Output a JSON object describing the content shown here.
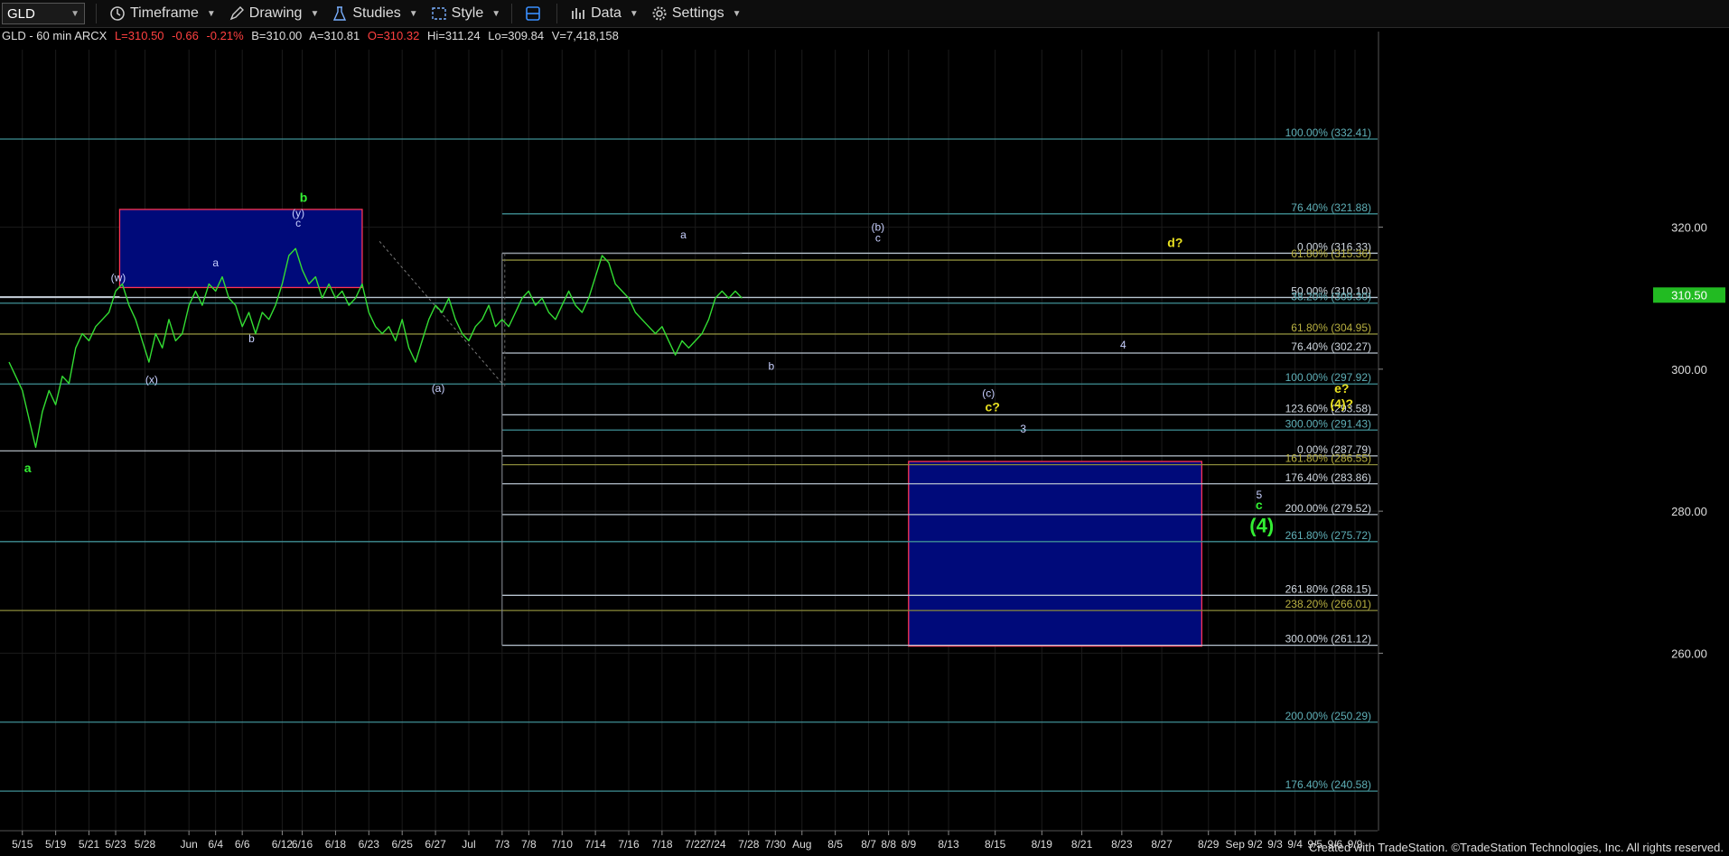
{
  "toolbar": {
    "symbol": "GLD",
    "items": [
      {
        "label": "Timeframe",
        "icon": "clock-icon"
      },
      {
        "label": "Drawing",
        "icon": "pencil-icon"
      },
      {
        "label": "Studies",
        "icon": "flask-icon"
      },
      {
        "label": "Style",
        "icon": "style-icon"
      },
      {
        "label": "",
        "icon": "layout-icon"
      },
      {
        "label": "Data",
        "icon": "bars-icon"
      },
      {
        "label": "Settings",
        "icon": "gear-icon"
      }
    ]
  },
  "infobar": {
    "symbol_info": "GLD - 60 min  ARCX",
    "last": "L=310.50",
    "change": "-0.66",
    "change_pct": "-0.21%",
    "bid": "B=310.00",
    "ask": "A=310.81",
    "open": "O=310.32",
    "high": "Hi=311.24",
    "low": "Lo=309.84",
    "volume": "V=7,418,158"
  },
  "footer": "Created with TradeStation. ©TradeStation Technologies, Inc. All rights reserved.",
  "colors": {
    "background": "#000000",
    "price_line": "#33dd33",
    "box_fill": "#000a7a",
    "box_border": "#ff3355",
    "fib_teal": "#3f8f95",
    "fib_white": "#b8c4d0",
    "fib_yellow": "#8a8a3a",
    "label_green": "#33ee33",
    "label_yellow": "#e8e020",
    "label_white": "#c8d0ff",
    "last_price_tag": "#22bb22"
  },
  "chart_data": {
    "type": "line",
    "title": "GLD - 60 min",
    "ylim": [
      235,
      345
    ],
    "xlim": [
      0,
      101
    ],
    "yticks": [
      260,
      280,
      300,
      320
    ],
    "last_price": "310.50",
    "x_tick_labels": [
      {
        "i": 1,
        "label": "5/15"
      },
      {
        "i": 3.5,
        "label": "5/19"
      },
      {
        "i": 6,
        "label": "5/21"
      },
      {
        "i": 8,
        "label": "5/23"
      },
      {
        "i": 10.2,
        "label": "5/28"
      },
      {
        "i": 13.5,
        "label": "Jun"
      },
      {
        "i": 15.5,
        "label": "6/4"
      },
      {
        "i": 17.5,
        "label": "6/6"
      },
      {
        "i": 20.5,
        "label": "6/12"
      },
      {
        "i": 22,
        "label": "6/16"
      },
      {
        "i": 24.5,
        "label": "6/18"
      },
      {
        "i": 27,
        "label": "6/23"
      },
      {
        "i": 29.5,
        "label": "6/25"
      },
      {
        "i": 32,
        "label": "6/27"
      },
      {
        "i": 34.5,
        "label": "Jul"
      },
      {
        "i": 37,
        "label": "7/3"
      },
      {
        "i": 39,
        "label": "7/8"
      },
      {
        "i": 41.5,
        "label": "7/10"
      },
      {
        "i": 44,
        "label": "7/14"
      },
      {
        "i": 46.5,
        "label": "7/16"
      },
      {
        "i": 49,
        "label": "7/18"
      },
      {
        "i": 51.5,
        "label": "7/22"
      },
      {
        "i": 53,
        "label": "7/24"
      },
      {
        "i": 55.5,
        "label": "7/28"
      },
      {
        "i": 57.5,
        "label": "7/30"
      },
      {
        "i": 59.5,
        "label": "Aug"
      },
      {
        "i": 62,
        "label": "8/5"
      },
      {
        "i": 64.5,
        "label": "8/7"
      },
      {
        "i": 66,
        "label": "8/8"
      },
      {
        "i": 67.5,
        "label": "8/9"
      },
      {
        "i": 70.5,
        "label": "8/13"
      },
      {
        "i": 74,
        "label": "8/15"
      },
      {
        "i": 77.5,
        "label": "8/19"
      },
      {
        "i": 80.5,
        "label": "8/21"
      },
      {
        "i": 83.5,
        "label": "8/23"
      },
      {
        "i": 86.5,
        "label": "8/27"
      },
      {
        "i": 90,
        "label": "8/29"
      },
      {
        "i": 92,
        "label": "Sep"
      },
      {
        "i": 93.5,
        "label": "9/2"
      },
      {
        "i": 95,
        "label": "9/3"
      },
      {
        "i": 96.5,
        "label": "9/4"
      },
      {
        "i": 98,
        "label": "9/5"
      },
      {
        "i": 99.5,
        "label": "9/6"
      },
      {
        "i": 101,
        "label": "9/9"
      }
    ],
    "series": [
      {
        "values": [
          [
            0,
            301
          ],
          [
            0.5,
            299
          ],
          [
            1,
            297
          ],
          [
            1.5,
            293
          ],
          [
            2,
            289
          ],
          [
            2.5,
            294
          ],
          [
            3,
            297
          ],
          [
            3.5,
            295
          ],
          [
            4,
            299
          ],
          [
            4.5,
            298
          ],
          [
            5,
            303
          ],
          [
            5.5,
            305
          ],
          [
            6,
            304
          ],
          [
            6.5,
            306
          ],
          [
            7,
            307
          ],
          [
            7.5,
            308
          ],
          [
            8,
            311
          ],
          [
            8.5,
            312
          ],
          [
            9,
            309
          ],
          [
            9.5,
            307
          ],
          [
            10,
            304
          ],
          [
            10.5,
            301
          ],
          [
            11,
            305
          ],
          [
            11.5,
            303
          ],
          [
            12,
            307
          ],
          [
            12.5,
            304
          ],
          [
            13,
            305
          ],
          [
            13.5,
            309
          ],
          [
            14,
            311
          ],
          [
            14.5,
            309
          ],
          [
            15,
            312
          ],
          [
            15.5,
            311
          ],
          [
            16,
            313
          ],
          [
            16.5,
            310
          ],
          [
            17,
            309
          ],
          [
            17.5,
            306
          ],
          [
            18,
            308
          ],
          [
            18.5,
            305
          ],
          [
            19,
            308
          ],
          [
            19.5,
            307
          ],
          [
            20,
            309
          ],
          [
            20.5,
            312
          ],
          [
            21,
            316
          ],
          [
            21.5,
            317
          ],
          [
            22,
            314
          ],
          [
            22.5,
            312
          ],
          [
            23,
            313
          ],
          [
            23.5,
            310
          ],
          [
            24,
            312
          ],
          [
            24.5,
            310
          ],
          [
            25,
            311
          ],
          [
            25.5,
            309
          ],
          [
            26,
            310
          ],
          [
            26.5,
            312
          ],
          [
            27,
            308
          ],
          [
            27.5,
            306
          ],
          [
            28,
            305
          ],
          [
            28.5,
            306
          ],
          [
            29,
            304
          ],
          [
            29.5,
            307
          ],
          [
            30,
            303
          ],
          [
            30.5,
            301
          ],
          [
            31,
            304
          ],
          [
            31.5,
            307
          ],
          [
            32,
            309
          ],
          [
            32.5,
            308
          ],
          [
            33,
            310
          ],
          [
            33.5,
            307
          ],
          [
            34,
            305
          ],
          [
            34.5,
            304
          ],
          [
            35,
            306
          ],
          [
            35.5,
            307
          ],
          [
            36,
            309
          ],
          [
            36.5,
            306
          ],
          [
            37,
            307
          ],
          [
            37.5,
            306
          ],
          [
            38,
            308
          ],
          [
            38.5,
            310
          ],
          [
            39,
            311
          ],
          [
            39.5,
            309
          ],
          [
            40,
            310
          ],
          [
            40.5,
            308
          ],
          [
            41,
            307
          ],
          [
            41.5,
            309
          ],
          [
            42,
            311
          ],
          [
            42.5,
            309
          ],
          [
            43,
            308
          ],
          [
            43.5,
            310
          ],
          [
            44,
            313
          ],
          [
            44.5,
            316
          ],
          [
            45,
            315
          ],
          [
            45.5,
            312
          ],
          [
            46,
            311
          ],
          [
            46.5,
            310
          ],
          [
            47,
            308
          ],
          [
            47.5,
            307
          ],
          [
            48,
            306
          ],
          [
            48.5,
            305
          ],
          [
            49,
            306
          ],
          [
            49.5,
            304
          ],
          [
            50,
            302
          ],
          [
            50.5,
            304
          ],
          [
            51,
            303
          ],
          [
            51.5,
            304
          ],
          [
            52,
            305
          ],
          [
            52.5,
            307
          ],
          [
            53,
            310
          ],
          [
            53.5,
            311
          ],
          [
            54,
            310
          ],
          [
            54.5,
            311
          ],
          [
            55,
            310
          ]
        ]
      }
    ],
    "fib_levels": [
      {
        "label": "100.00% (332.41)",
        "y": 332.41,
        "color": "#3f8f95"
      },
      {
        "label": "76.40% (321.88)",
        "y": 321.88,
        "color": "#3f8f95"
      },
      {
        "label": "0.00% (316.33)",
        "y": 316.33,
        "color": "#b8c4d0"
      },
      {
        "label": "61.80% (315.36)",
        "y": 315.36,
        "color": "#8a8a3a"
      },
      {
        "label": "50.00% (310.10)",
        "y": 310.1,
        "color": "#b8c4d0"
      },
      {
        "label": "38.20% (309.30)",
        "y": 309.3,
        "color": "#3f8f95"
      },
      {
        "label": "61.80% (304.95)",
        "y": 304.95,
        "color": "#8a8a3a"
      },
      {
        "label": "76.40% (302.27)",
        "y": 302.27,
        "color": "#b8c4d0"
      },
      {
        "label": "100.00% (297.92)",
        "y": 297.92,
        "color": "#3f8f95"
      },
      {
        "label": "123.60% (293.58)",
        "y": 293.58,
        "color": "#b8c4d0"
      },
      {
        "label": "300.00% (291.43)",
        "y": 291.43,
        "color": "#3f8f95"
      },
      {
        "label": "0.00% (287.79)",
        "y": 287.79,
        "color": "#b8c4d0"
      },
      {
        "label": "161.80% (286.55)",
        "y": 286.55,
        "color": "#8a8a3a"
      },
      {
        "label": "176.40% (283.86)",
        "y": 283.86,
        "color": "#b8c4d0"
      },
      {
        "label": "200.00% (279.52)",
        "y": 279.52,
        "color": "#b8c4d0"
      },
      {
        "label": "261.80% (275.72)",
        "y": 275.72,
        "color": "#3f8f95"
      },
      {
        "label": "261.80% (268.15)",
        "y": 268.15,
        "color": "#b8c4d0"
      },
      {
        "label": "238.20% (266.01)",
        "y": 266.01,
        "color": "#8a8a3a"
      },
      {
        "label": "300.00% (261.12)",
        "y": 261.12,
        "color": "#b8c4d0"
      },
      {
        "label": "200.00% (250.29)",
        "y": 250.29,
        "color": "#3f8f95"
      },
      {
        "label": "176.40% (240.58)",
        "y": 240.58,
        "color": "#3f8f95"
      }
    ],
    "boxes": [
      {
        "x": [
          8.3,
          26.5
        ],
        "y": [
          311.5,
          322.5
        ]
      },
      {
        "x": [
          67.5,
          89.5
        ],
        "y": [
          261.0,
          287.0
        ]
      }
    ],
    "annotations": [
      {
        "text": "b",
        "x": 22.1,
        "y": 323.6,
        "color": "#33ee33",
        "size": 14
      },
      {
        "text": "(y)",
        "x": 21.7,
        "y": 321.5,
        "color": "#c8d0ff",
        "size": 12
      },
      {
        "text": "c",
        "x": 21.7,
        "y": 320.1,
        "color": "#c8d0ff",
        "size": 12
      },
      {
        "text": "(w)",
        "x": 8.2,
        "y": 312.4,
        "color": "#c8d0ff",
        "size": 12
      },
      {
        "text": "a",
        "x": 15.5,
        "y": 314.5,
        "color": "#c8d0ff",
        "size": 12
      },
      {
        "text": "b",
        "x": 18.2,
        "y": 303.8,
        "color": "#c8d0ff",
        "size": 12
      },
      {
        "text": "(x)",
        "x": 10.7,
        "y": 298.0,
        "color": "#c8d0ff",
        "size": 12
      },
      {
        "text": "a",
        "x": 1.4,
        "y": 285.5,
        "color": "#33ee33",
        "size": 14
      },
      {
        "text": "(a)",
        "x": 32.2,
        "y": 296.8,
        "color": "#c8d0ff",
        "size": 12
      },
      {
        "text": "a",
        "x": 50.6,
        "y": 318.4,
        "color": "#c8d0ff",
        "size": 12
      },
      {
        "text": "b",
        "x": 57.2,
        "y": 299.9,
        "color": "#c8d0ff",
        "size": 12
      },
      {
        "text": "(b)",
        "x": 65.2,
        "y": 319.5,
        "color": "#c8d0ff",
        "size": 12
      },
      {
        "text": "c",
        "x": 65.2,
        "y": 318.0,
        "color": "#c8d0ff",
        "size": 12
      },
      {
        "text": "d?",
        "x": 87.5,
        "y": 317.2,
        "color": "#e8e020",
        "size": 14
      },
      {
        "text": "4",
        "x": 83.6,
        "y": 302.9,
        "color": "#c8d0ff",
        "size": 12
      },
      {
        "text": "(c)",
        "x": 73.5,
        "y": 296.1,
        "color": "#c8d0ff",
        "size": 12
      },
      {
        "text": "c?",
        "x": 73.8,
        "y": 294.1,
        "color": "#e8e020",
        "size": 14
      },
      {
        "text": "3",
        "x": 76.1,
        "y": 291.1,
        "color": "#c8d0ff",
        "size": 12
      },
      {
        "text": "e?",
        "x": 100.0,
        "y": 296.7,
        "color": "#e8e020",
        "size": 14
      },
      {
        "text": "(4)?",
        "x": 100.0,
        "y": 294.5,
        "color": "#e8e020",
        "size": 14
      },
      {
        "text": "5",
        "x": 93.8,
        "y": 281.8,
        "color": "#c8d0ff",
        "size": 12
      },
      {
        "text": "c",
        "x": 93.8,
        "y": 280.3,
        "color": "#33ee33",
        "size": 14
      },
      {
        "text": "(4)",
        "x": 94.0,
        "y": 277.0,
        "color": "#33ee33",
        "size": 22
      }
    ]
  }
}
